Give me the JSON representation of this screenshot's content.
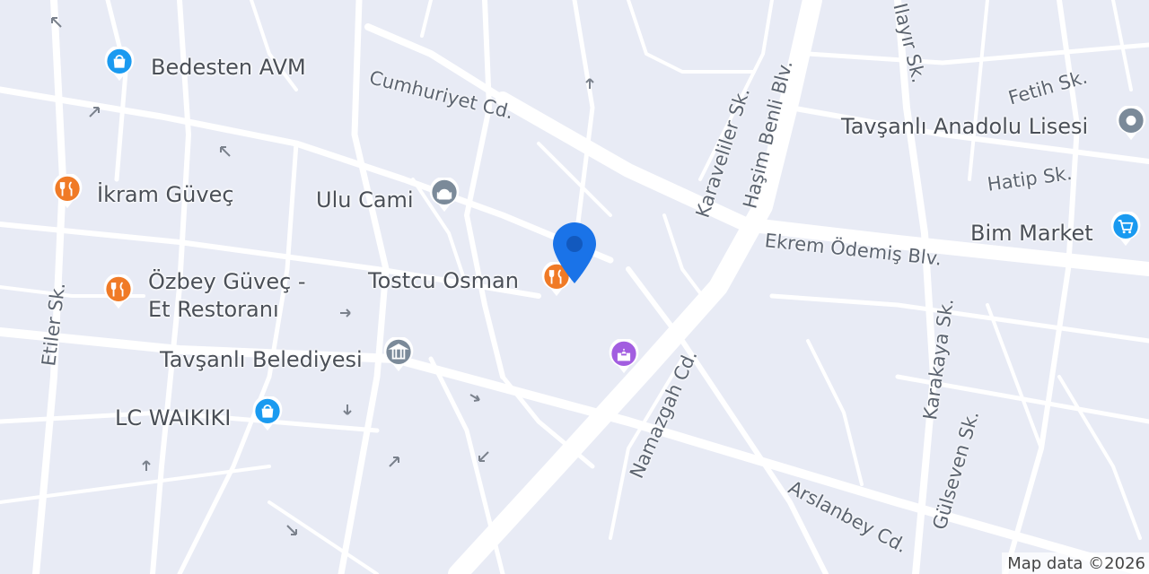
{
  "map": {
    "attribution": "Map data ©2026",
    "streets": [
      {
        "name": "Cumhuriyet Cd."
      },
      {
        "name": "Haşim Benli Blv."
      },
      {
        "name": "Karaveliler Sk."
      },
      {
        "name": "Fetih Sk."
      },
      {
        "name": "Hatip Sk."
      },
      {
        "name": "Ekrem Ödemiş Blv."
      },
      {
        "name": "Etiler Sk."
      },
      {
        "name": "Namazgah Cd."
      },
      {
        "name": "Karakaya Sk."
      },
      {
        "name": "Gülseven Sk."
      },
      {
        "name": "Arslanbey Cd."
      },
      {
        "name": "Ilayır Sk."
      }
    ],
    "places": [
      {
        "name": "Bedesten AVM",
        "category": "shopping",
        "icon": "shopping-bag-icon",
        "color": "#1a9af0"
      },
      {
        "name": "İkram Güveç",
        "category": "restaurant",
        "icon": "fork-knife-icon",
        "color": "#f07a26"
      },
      {
        "name": "Ulu Cami",
        "category": "mosque",
        "icon": "mosque-icon",
        "color": "#7b8a99"
      },
      {
        "name": "Tostcu Osman",
        "category": "restaurant",
        "icon": "fork-knife-icon",
        "color": "#f07a26"
      },
      {
        "name": "Özbey Güveç - Et Restoranı",
        "name_line1": "Özbey Güveç -",
        "name_line2": "Et Restoranı",
        "category": "restaurant",
        "icon": "fork-knife-icon",
        "color": "#f07a26"
      },
      {
        "name": "Tavşanlı Belediyesi",
        "category": "government",
        "icon": "government-building-icon",
        "color": "#7b8a99"
      },
      {
        "name": "LC WAIKIKI",
        "category": "shopping",
        "icon": "shopping-bag-icon",
        "color": "#1a9af0"
      },
      {
        "name": "Tavşanlı Anadolu Lisesi",
        "category": "school",
        "icon": "school-icon",
        "color": "#7b8a99"
      },
      {
        "name": "Bim Market",
        "category": "grocery",
        "icon": "shopping-cart-icon",
        "color": "#1a9af0"
      },
      {
        "name": "",
        "category": "landmark",
        "icon": "landmark-icon",
        "color": "#a25de0"
      }
    ],
    "marker": {
      "icon": "location-marker-icon",
      "color": "#1a73e8"
    }
  }
}
